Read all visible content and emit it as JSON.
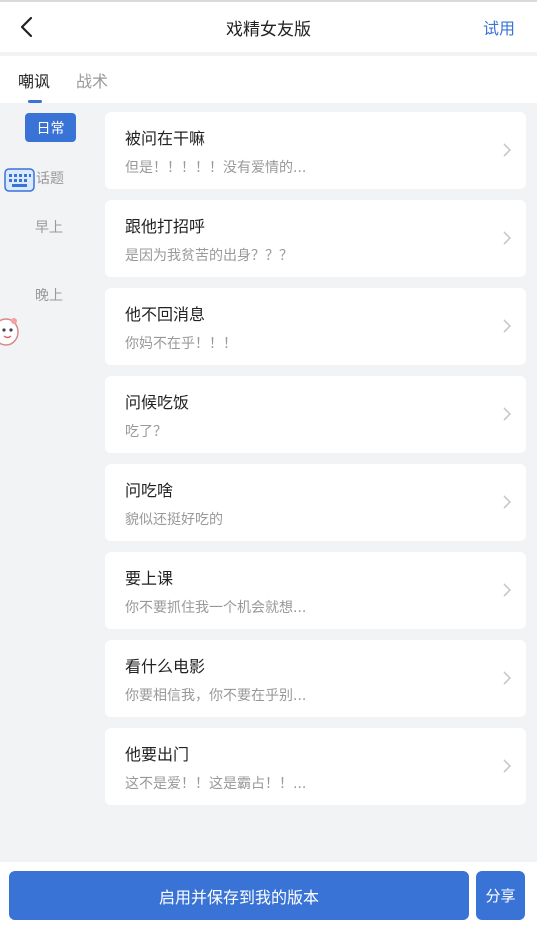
{
  "header": {
    "title": "戏精女友版",
    "try_label": "试用"
  },
  "tabs": [
    {
      "label": "嘲讽",
      "active": true
    },
    {
      "label": "战术",
      "active": false
    }
  ],
  "sidebar": {
    "items": [
      {
        "label": "日常",
        "active": true
      },
      {
        "label": "话题",
        "active": false
      },
      {
        "label": "早上",
        "active": false
      },
      {
        "label": "晚上",
        "active": false
      }
    ]
  },
  "cards": [
    {
      "title": "被问在干嘛",
      "subtitle": "但是！！！！！没有爱情的..."
    },
    {
      "title": "跟他打招呼",
      "subtitle": "是因为我贫苦的出身？？？"
    },
    {
      "title": "他不回消息",
      "subtitle": "你妈不在乎！！！"
    },
    {
      "title": "问候吃饭",
      "subtitle": "吃了？"
    },
    {
      "title": "问吃啥",
      "subtitle": "貌似还挺好吃的"
    },
    {
      "title": "要上课",
      "subtitle": "你不要抓住我一个机会就想..."
    },
    {
      "title": "看什么电影",
      "subtitle": "你要相信我，你不要在乎别..."
    },
    {
      "title": "他要出门",
      "subtitle": "这不是爱！！这是霸占！！..."
    }
  ],
  "footer": {
    "save_label": "启用并保存到我的版本",
    "share_label": "分享"
  },
  "colors": {
    "accent": "#3a73d6",
    "background": "#f2f3f5",
    "muted_text": "#999999"
  },
  "icons": [
    "back-arrow-icon",
    "chevron-right-icon",
    "keyboard-icon",
    "mascot-icon"
  ]
}
